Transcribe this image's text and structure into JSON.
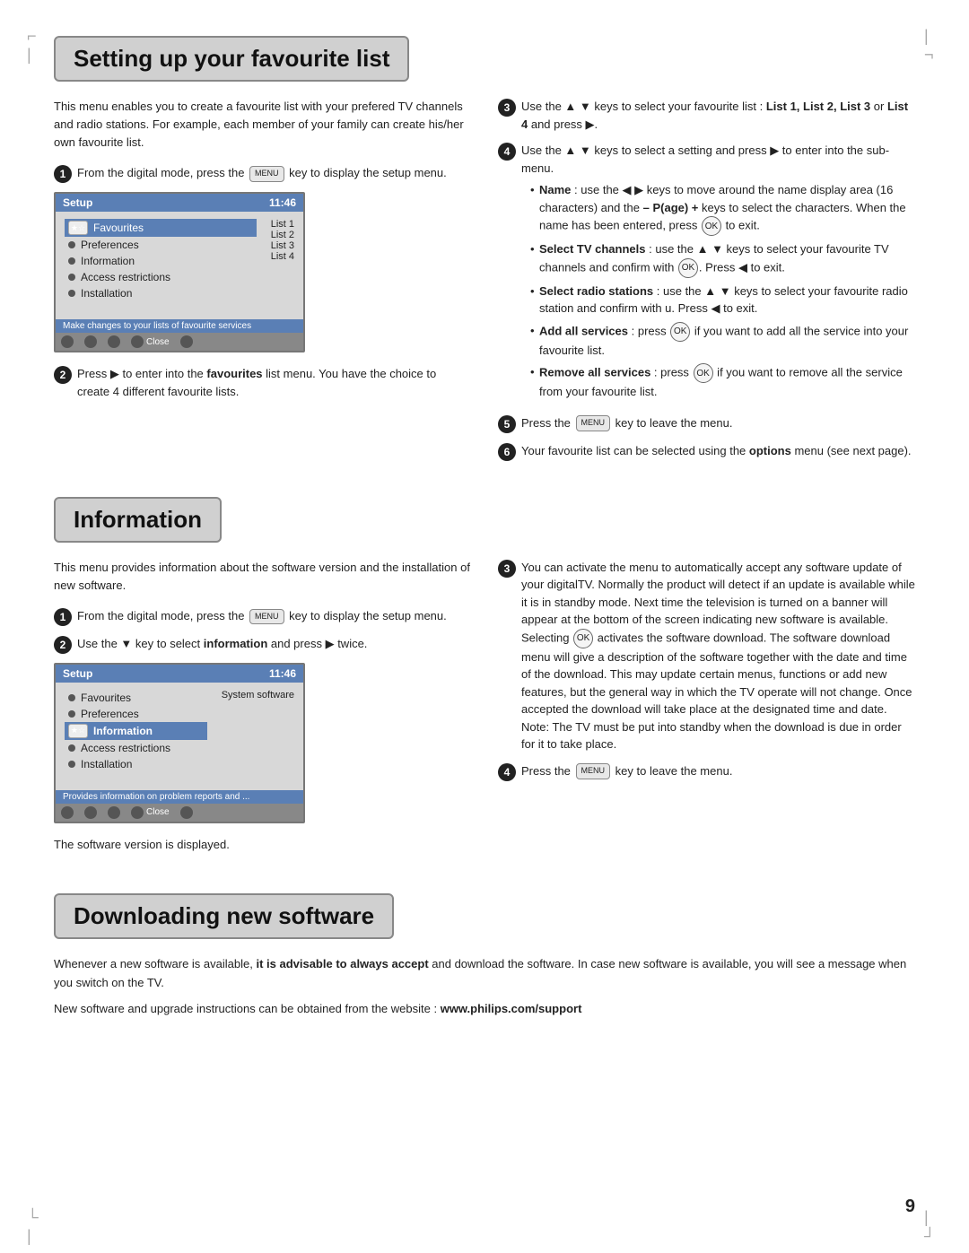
{
  "page": {
    "number": "9",
    "corners": {
      "tl": "⌐",
      "tr": "¬",
      "bl": "└",
      "br": "┘"
    }
  },
  "section1": {
    "title": "Setting up your favourite list",
    "intro": "This menu enables you to create a favourite list with your prefered TV channels and radio stations. For example, each member of your family can create his/her own favourite list.",
    "steps_left": [
      {
        "num": "1",
        "text": "From the digital mode, press the",
        "text2": "key to display the setup menu."
      },
      {
        "num": "2",
        "text": "Press ▶ to enter into the favourites list menu. You have the choice to create 4 different favourite lists."
      }
    ],
    "steps_right": [
      {
        "num": "3",
        "text": "Use the ▲ ▼ keys to select your favourite list : List 1, List 2, List 3 or List 4 and press ▶."
      },
      {
        "num": "4",
        "text": "Use the ▲ ▼ keys to select a setting and press ▶ to enter into the sub-menu.",
        "bullets": [
          "Name : use the ◀ ▶ keys to move around the name display area (16 characters) and the – P(age) + keys to select the characters. When the name has been entered, press OK to exit.",
          "Select TV channels : use the ▲ ▼ keys to select your favourite TV channels and confirm with OK. Press ◀ to exit.",
          "Select radio stations : use the ▲ ▼ keys to select your favourite radio station and confirm with u. Press ◀ to exit.",
          "Add all services : press OK if you want to add all the service into your favourite list.",
          "Remove all services : press OK if you want to remove all the service from your favourite list."
        ]
      },
      {
        "num": "5",
        "text": "Press the",
        "text2": "key to leave the menu."
      },
      {
        "num": "6",
        "text": "Your favourite list can be selected using the options menu (see next page)."
      }
    ],
    "screen1": {
      "title": "Setup",
      "time": "11:46",
      "menu_items": [
        {
          "label": "Favourites",
          "sub": "List 1",
          "selected": true,
          "hasFavIcon": true
        },
        {
          "label": "Preferences",
          "sub": "List 2",
          "selected": false
        },
        {
          "label": "Information",
          "sub": "List 3",
          "selected": false
        },
        {
          "label": "Access restrictions",
          "sub": "List 4",
          "selected": false
        },
        {
          "label": "Installation",
          "sub": "",
          "selected": false
        }
      ],
      "status_bar": "Make changes to your lists of favourite services",
      "buttons": [
        "○",
        "○",
        "○",
        "○ Close",
        "○"
      ]
    }
  },
  "section2": {
    "title": "Information",
    "intro_left": "This menu provides information about the software version and the installation of new software.",
    "steps_left": [
      {
        "num": "1",
        "text": "From the digital mode, press the",
        "text2": "key to display the setup menu."
      },
      {
        "num": "2",
        "text": "Use the ▼ key to select information and press ▶ twice."
      }
    ],
    "steps_right": [
      {
        "num": "3",
        "text": "You can activate the menu to automatically accept any software update of your digitalTV. Normally the product will detect if an update is available while it is in standby mode. Next time the television is turned on a banner will appear at the bottom of the screen indicating new software is available. Selecting OK activates the software download. The software download menu will give a description of the software together with the date and time of the download. This may update certain menus, functions or add new features, but the general way in which the TV operate will not change. Once accepted the download will take place at the designated time and date. Note: The TV must be put into standby when the download is due in order for it to take place."
      },
      {
        "num": "4",
        "text": "Press the",
        "text2": "key to leave the menu."
      }
    ],
    "screen2": {
      "title": "Setup",
      "time": "11:46",
      "menu_items": [
        {
          "label": "Favourites",
          "sub": "System software",
          "selected": false
        },
        {
          "label": "Preferences",
          "sub": "",
          "selected": false
        },
        {
          "label": "Information",
          "sub": "",
          "selected": true,
          "hasFavIcon": true
        },
        {
          "label": "Access restrictions",
          "sub": "",
          "selected": false
        },
        {
          "label": "Installation",
          "sub": "",
          "selected": false
        }
      ],
      "status_bar": "Provides information on problem reports and ...",
      "buttons": [
        "○",
        "○",
        "○",
        "○ Close",
        "○"
      ]
    },
    "software_displayed": "The software version is displayed."
  },
  "section3": {
    "title": "Downloading new software",
    "para1": "Whenever a new software is available, it is advisable to always accept and download the software. In case new software is available, you will see a message when you switch on the TV.",
    "para2": "New software and upgrade instructions can be obtained from the website : www.philips.com/support"
  }
}
